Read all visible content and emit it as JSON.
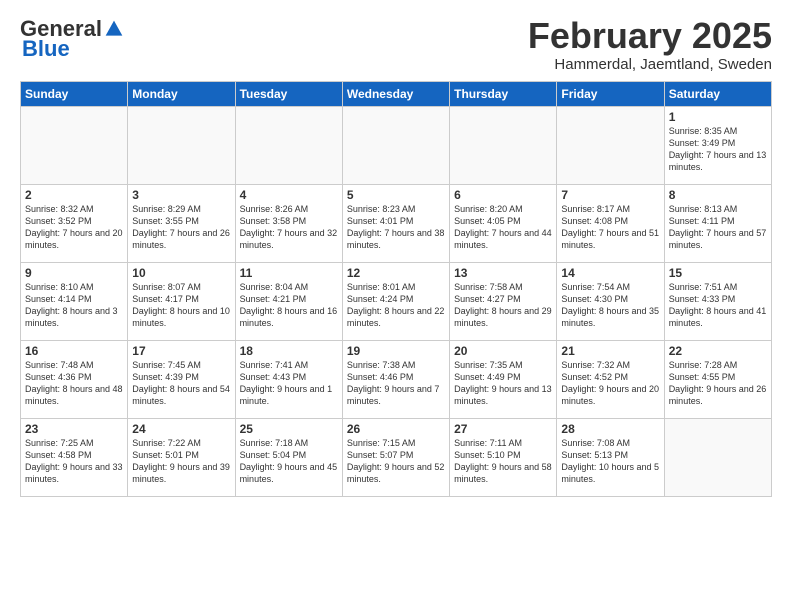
{
  "logo": {
    "general": "General",
    "blue": "Blue"
  },
  "title": {
    "month": "February 2025",
    "location": "Hammerdal, Jaemtland, Sweden"
  },
  "days_of_week": [
    "Sunday",
    "Monday",
    "Tuesday",
    "Wednesday",
    "Thursday",
    "Friday",
    "Saturday"
  ],
  "weeks": [
    [
      {
        "day": "",
        "info": ""
      },
      {
        "day": "",
        "info": ""
      },
      {
        "day": "",
        "info": ""
      },
      {
        "day": "",
        "info": ""
      },
      {
        "day": "",
        "info": ""
      },
      {
        "day": "",
        "info": ""
      },
      {
        "day": "1",
        "info": "Sunrise: 8:35 AM\nSunset: 3:49 PM\nDaylight: 7 hours\nand 13 minutes."
      }
    ],
    [
      {
        "day": "2",
        "info": "Sunrise: 8:32 AM\nSunset: 3:52 PM\nDaylight: 7 hours\nand 20 minutes."
      },
      {
        "day": "3",
        "info": "Sunrise: 8:29 AM\nSunset: 3:55 PM\nDaylight: 7 hours\nand 26 minutes."
      },
      {
        "day": "4",
        "info": "Sunrise: 8:26 AM\nSunset: 3:58 PM\nDaylight: 7 hours\nand 32 minutes."
      },
      {
        "day": "5",
        "info": "Sunrise: 8:23 AM\nSunset: 4:01 PM\nDaylight: 7 hours\nand 38 minutes."
      },
      {
        "day": "6",
        "info": "Sunrise: 8:20 AM\nSunset: 4:05 PM\nDaylight: 7 hours\nand 44 minutes."
      },
      {
        "day": "7",
        "info": "Sunrise: 8:17 AM\nSunset: 4:08 PM\nDaylight: 7 hours\nand 51 minutes."
      },
      {
        "day": "8",
        "info": "Sunrise: 8:13 AM\nSunset: 4:11 PM\nDaylight: 7 hours\nand 57 minutes."
      }
    ],
    [
      {
        "day": "9",
        "info": "Sunrise: 8:10 AM\nSunset: 4:14 PM\nDaylight: 8 hours\nand 3 minutes."
      },
      {
        "day": "10",
        "info": "Sunrise: 8:07 AM\nSunset: 4:17 PM\nDaylight: 8 hours\nand 10 minutes."
      },
      {
        "day": "11",
        "info": "Sunrise: 8:04 AM\nSunset: 4:21 PM\nDaylight: 8 hours\nand 16 minutes."
      },
      {
        "day": "12",
        "info": "Sunrise: 8:01 AM\nSunset: 4:24 PM\nDaylight: 8 hours\nand 22 minutes."
      },
      {
        "day": "13",
        "info": "Sunrise: 7:58 AM\nSunset: 4:27 PM\nDaylight: 8 hours\nand 29 minutes."
      },
      {
        "day": "14",
        "info": "Sunrise: 7:54 AM\nSunset: 4:30 PM\nDaylight: 8 hours\nand 35 minutes."
      },
      {
        "day": "15",
        "info": "Sunrise: 7:51 AM\nSunset: 4:33 PM\nDaylight: 8 hours\nand 41 minutes."
      }
    ],
    [
      {
        "day": "16",
        "info": "Sunrise: 7:48 AM\nSunset: 4:36 PM\nDaylight: 8 hours\nand 48 minutes."
      },
      {
        "day": "17",
        "info": "Sunrise: 7:45 AM\nSunset: 4:39 PM\nDaylight: 8 hours\nand 54 minutes."
      },
      {
        "day": "18",
        "info": "Sunrise: 7:41 AM\nSunset: 4:43 PM\nDaylight: 9 hours\nand 1 minute."
      },
      {
        "day": "19",
        "info": "Sunrise: 7:38 AM\nSunset: 4:46 PM\nDaylight: 9 hours\nand 7 minutes."
      },
      {
        "day": "20",
        "info": "Sunrise: 7:35 AM\nSunset: 4:49 PM\nDaylight: 9 hours\nand 13 minutes."
      },
      {
        "day": "21",
        "info": "Sunrise: 7:32 AM\nSunset: 4:52 PM\nDaylight: 9 hours\nand 20 minutes."
      },
      {
        "day": "22",
        "info": "Sunrise: 7:28 AM\nSunset: 4:55 PM\nDaylight: 9 hours\nand 26 minutes."
      }
    ],
    [
      {
        "day": "23",
        "info": "Sunrise: 7:25 AM\nSunset: 4:58 PM\nDaylight: 9 hours\nand 33 minutes."
      },
      {
        "day": "24",
        "info": "Sunrise: 7:22 AM\nSunset: 5:01 PM\nDaylight: 9 hours\nand 39 minutes."
      },
      {
        "day": "25",
        "info": "Sunrise: 7:18 AM\nSunset: 5:04 PM\nDaylight: 9 hours\nand 45 minutes."
      },
      {
        "day": "26",
        "info": "Sunrise: 7:15 AM\nSunset: 5:07 PM\nDaylight: 9 hours\nand 52 minutes."
      },
      {
        "day": "27",
        "info": "Sunrise: 7:11 AM\nSunset: 5:10 PM\nDaylight: 9 hours\nand 58 minutes."
      },
      {
        "day": "28",
        "info": "Sunrise: 7:08 AM\nSunset: 5:13 PM\nDaylight: 10 hours\nand 5 minutes."
      },
      {
        "day": "",
        "info": ""
      }
    ]
  ]
}
